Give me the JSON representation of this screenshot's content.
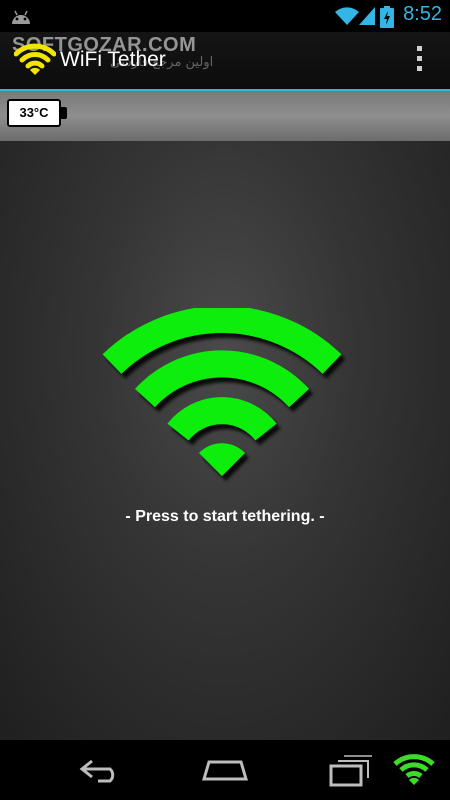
{
  "status_bar": {
    "time": "8:52",
    "icons": [
      "android-icon",
      "wifi-signal-icon",
      "cell-signal-icon",
      "battery-charging-icon"
    ],
    "accent_color": "#33b5e5"
  },
  "action_bar": {
    "title": "WiFi Tether",
    "watermark": "SOFTGOZAR.COM",
    "watermark_sub": "اولین مرجع فارسی",
    "app_icon": "wifi-icon",
    "menu_icon": "overflow-menu-icon"
  },
  "temperature": {
    "label": "33°C"
  },
  "main": {
    "hint": "- Press to start tethering. -",
    "wifi_color": "#11ee11"
  },
  "nav_bar": {
    "icons": [
      "back-icon",
      "home-icon",
      "recent-apps-icon",
      "wifi-tether-icon"
    ]
  }
}
